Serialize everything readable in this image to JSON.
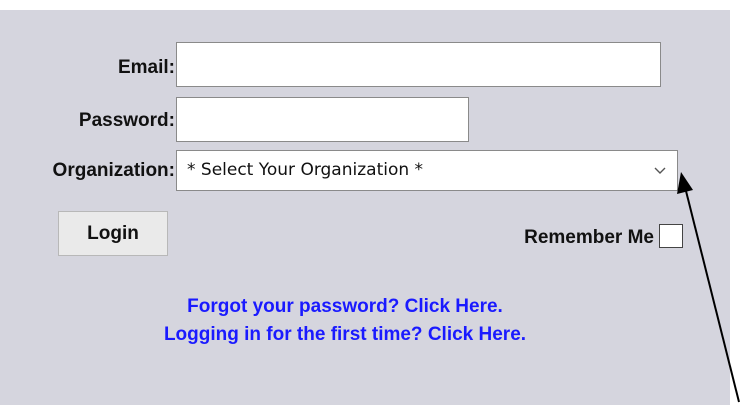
{
  "form": {
    "email_label": "Email:",
    "email_value": "",
    "password_label": "Password:",
    "password_value": "",
    "organization_label": "Organization:",
    "organization_selected": "* Select Your Organization *",
    "login_label": "Login",
    "remember_label": "Remember Me",
    "remember_checked": false
  },
  "links": {
    "forgot_password": "Forgot your password? Click Here.",
    "first_time": "Logging in for the first time? Click Here."
  },
  "colors": {
    "panel_background": "#d5d5de",
    "link": "#1a1aff"
  },
  "icons": {
    "select_chevron": "chevron-down-icon",
    "annotation_arrow": "arrow-icon"
  }
}
